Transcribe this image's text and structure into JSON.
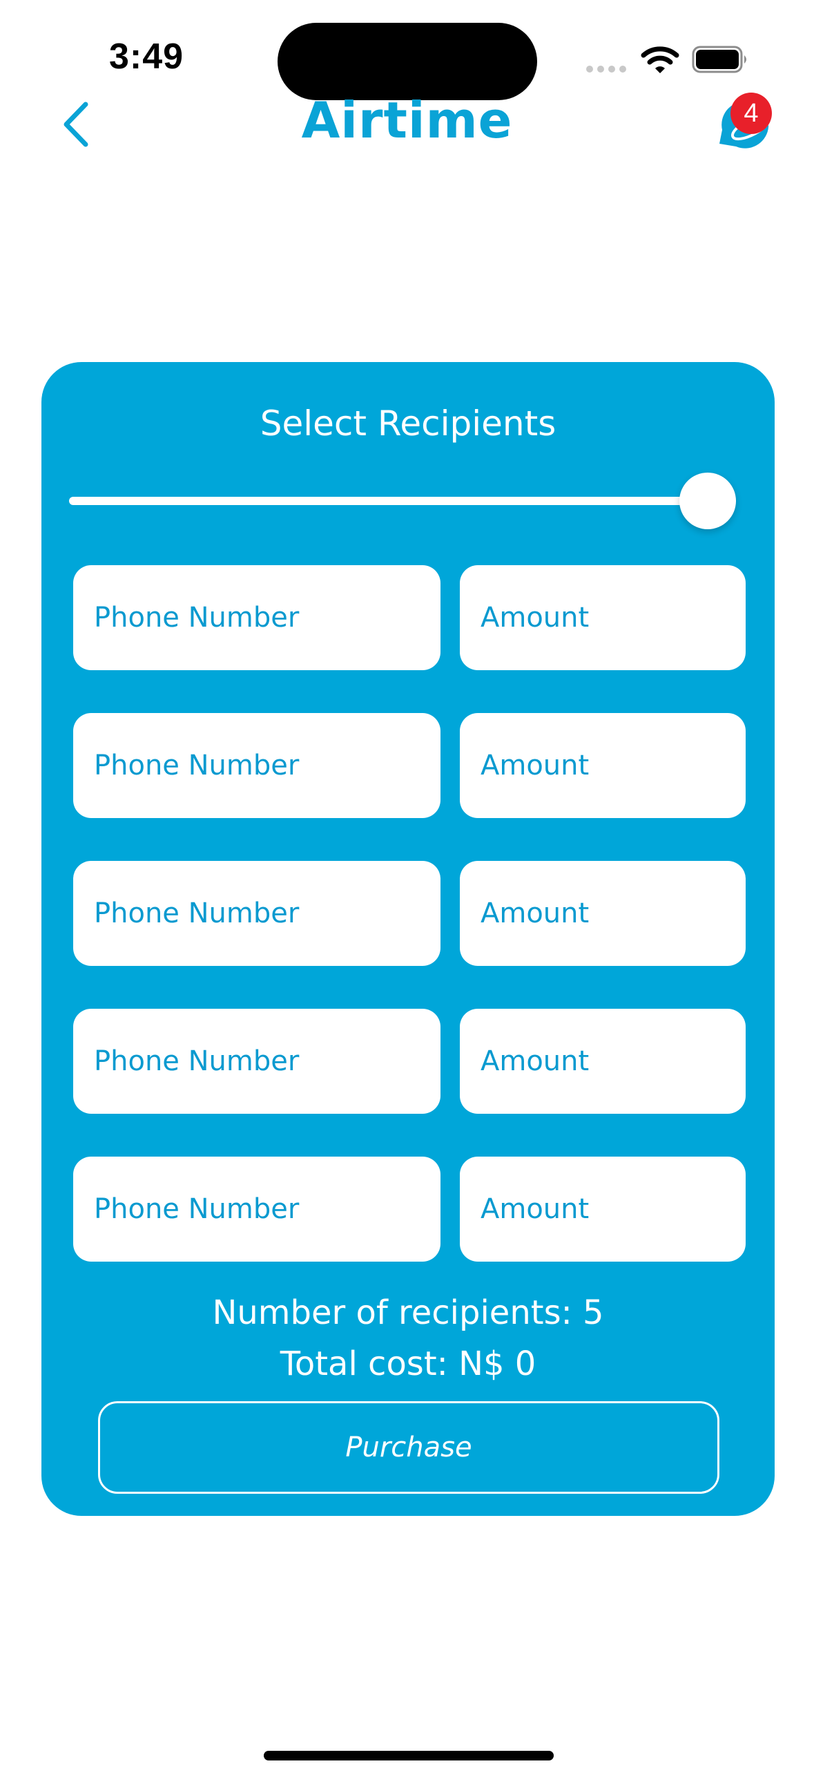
{
  "status_bar": {
    "time": "3:49"
  },
  "header": {
    "title": "Airtime",
    "notification_count": "4"
  },
  "icons": {
    "back": "chevron-left-icon",
    "notifications": "chat-bubble-icon",
    "wifi": "wifi-icon",
    "battery": "battery-icon"
  },
  "colors": {
    "accent": "#00a6d9",
    "badge": "#e8202a",
    "white": "#ffffff"
  },
  "card": {
    "title": "Select Recipients",
    "slider_fraction": 1.0,
    "rows": [
      {
        "phone_placeholder": "Phone Number",
        "amount_placeholder": "Amount"
      },
      {
        "phone_placeholder": "Phone Number",
        "amount_placeholder": "Amount"
      },
      {
        "phone_placeholder": "Phone Number",
        "amount_placeholder": "Amount"
      },
      {
        "phone_placeholder": "Phone Number",
        "amount_placeholder": "Amount"
      },
      {
        "phone_placeholder": "Phone Number",
        "amount_placeholder": "Amount"
      }
    ],
    "recipients_text": "Number of recipients: 5",
    "total_text": "Total cost: N$ 0",
    "purchase_label": "Purchase"
  }
}
